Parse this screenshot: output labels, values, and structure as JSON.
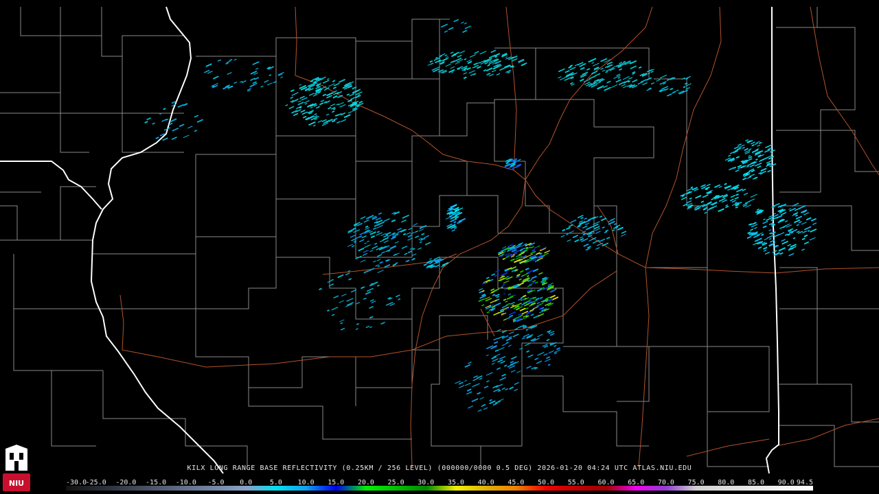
{
  "product_title": "KILX LONG RANGE BASE REFLECTIVITY (0.25KM / 256 LEVEL) (000000/0000 0.5 DEG) 2026-01-20 04:24 UTC  ATLAS.NIU.EDU",
  "logo": {
    "text": "NIU",
    "color": "#c8102e"
  },
  "colors": {
    "background": "#000000",
    "county_lines": "#8a8a8a",
    "state_lines": "#ffffff",
    "highways": "#b5542a"
  },
  "colorbar": {
    "min": -30.0,
    "max": 94.5,
    "labels": [
      "-30.0",
      "-25.0",
      "-20.0",
      "-15.0",
      "-10.0",
      "-5.0",
      "0.0",
      "5.0",
      "10.0",
      "15.0",
      "20.0",
      "25.0",
      "30.0",
      "35.0",
      "40.0",
      "45.0",
      "50.0",
      "55.0",
      "60.0",
      "65.0",
      "70.0",
      "75.0",
      "80.0",
      "85.0",
      "90.0",
      "94.5"
    ],
    "stops": [
      {
        "value": -30,
        "color": "#111111"
      },
      {
        "value": 0,
        "color": "#8aa0c8"
      },
      {
        "value": 5,
        "color": "#00e0f0"
      },
      {
        "value": 10,
        "color": "#10a0f0"
      },
      {
        "value": 15,
        "color": "#0000f0"
      },
      {
        "value": 20,
        "color": "#00f000"
      },
      {
        "value": 25,
        "color": "#00c000"
      },
      {
        "value": 30,
        "color": "#008800"
      },
      {
        "value": 35,
        "color": "#f0f000"
      },
      {
        "value": 40,
        "color": "#e0b000"
      },
      {
        "value": 45,
        "color": "#f08000"
      },
      {
        "value": 50,
        "color": "#f00000"
      },
      {
        "value": 55,
        "color": "#c00000"
      },
      {
        "value": 60,
        "color": "#a00000"
      },
      {
        "value": 65,
        "color": "#f000f0"
      },
      {
        "value": 70,
        "color": "#9040d0"
      },
      {
        "value": 75,
        "color": "#d0d0d0"
      },
      {
        "value": 94.5,
        "color": "#ffffff"
      }
    ]
  }
}
